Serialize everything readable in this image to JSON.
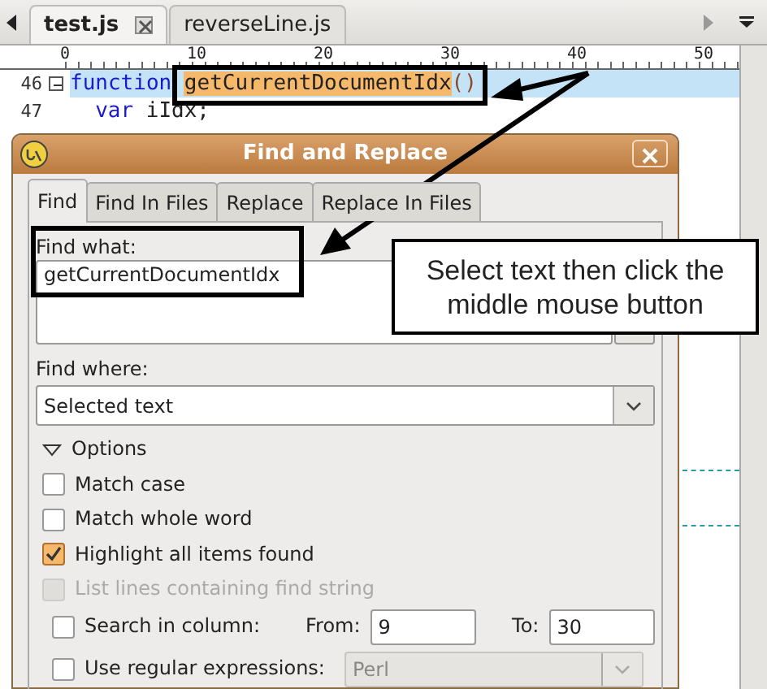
{
  "editor_tabs": [
    {
      "label": "test.js",
      "selected": true,
      "closable": true
    },
    {
      "label": "reverseLine.js",
      "selected": false,
      "closable": false
    }
  ],
  "ruler": [
    "0",
    "10",
    "20",
    "30",
    "40",
    "50"
  ],
  "code_lines": [
    {
      "number": "46",
      "current": true,
      "foldable": true,
      "indented": false,
      "tokens": [
        {
          "kind": "keyword",
          "text": "function"
        },
        {
          "kind": "match",
          "text": "getCurrentDocumentIdx"
        },
        {
          "kind": "paren",
          "text": "()"
        }
      ]
    },
    {
      "number": "47",
      "current": false,
      "foldable": false,
      "indented": true,
      "tokens": [
        {
          "kind": "keyword",
          "text": "var"
        },
        {
          "kind": "plain",
          "text": "iIdx;"
        }
      ]
    }
  ],
  "dialog": {
    "title": "Find and Replace",
    "tabs": [
      {
        "label": "Find",
        "selected": true
      },
      {
        "label": "Find In Files",
        "selected": false
      },
      {
        "label": "Replace",
        "selected": false
      },
      {
        "label": "Replace In Files",
        "selected": false
      }
    ],
    "find_what": {
      "label": "Find what:",
      "value": "getCurrentDocumentIdx"
    },
    "find_where": {
      "label": "Find where:",
      "value": "Selected text"
    },
    "options": {
      "label": "Options",
      "expanded": true
    },
    "checks": [
      {
        "label": "Match case",
        "checked": false,
        "disabled": false
      },
      {
        "label": "Match whole word",
        "checked": false,
        "disabled": false
      },
      {
        "label": "Highlight all items found",
        "checked": true,
        "disabled": false
      },
      {
        "label": "List lines containing find string",
        "checked": false,
        "disabled": true
      }
    ],
    "search_in_column": {
      "label": "Search in column:",
      "checked": false,
      "from_label": "From:",
      "from": "9",
      "to_label": "To:",
      "to": "30"
    },
    "regex": {
      "label": "Use regular expressions:",
      "checked": false,
      "value": "Perl",
      "disabled": true
    }
  },
  "callout": {
    "text": "Select text then click the middle mouse button"
  }
}
